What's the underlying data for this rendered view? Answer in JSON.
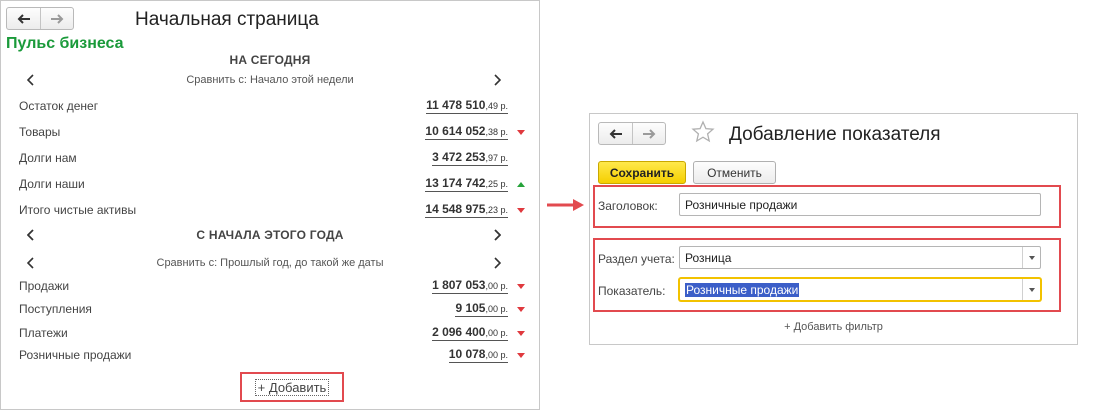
{
  "left": {
    "window_title": "Начальная страница",
    "brand": "Пульс бизнеса",
    "section_today": {
      "heading": "НА СЕГОДНЯ",
      "compare": "Сравнить с: Начало этой недели",
      "rows": [
        {
          "label": "Остаток денег",
          "int": "11 478 510",
          "dec": ",49 р.",
          "trend": "none"
        },
        {
          "label": "Товары",
          "int": "10 614 052",
          "dec": ",38 р.",
          "trend": "down"
        },
        {
          "label": "Долги нам",
          "int": "3 472 253",
          "dec": ",97 р.",
          "trend": "none"
        },
        {
          "label": "Долги наши",
          "int": "13 174 742",
          "dec": ",25 р.",
          "trend": "up"
        },
        {
          "label": "Итого чистые активы",
          "int": "14 548 975",
          "dec": ",23 р.",
          "trend": "down"
        }
      ]
    },
    "section_year": {
      "heading": "С НАЧАЛА ЭТОГО ГОДА",
      "compare": "Сравнить с: Прошлый год, до такой же даты",
      "rows": [
        {
          "label": "Продажи",
          "int": "1 807 053",
          "dec": ",00 р.",
          "trend": "down"
        },
        {
          "label": "Поступления",
          "int": "9 105",
          "dec": ",00 р.",
          "trend": "down"
        },
        {
          "label": "Платежи",
          "int": "2 096 400",
          "dec": ",00 р.",
          "trend": "down"
        },
        {
          "label": "Розничные продажи",
          "int": "10 078",
          "dec": ",00 р.",
          "trend": "down"
        }
      ]
    },
    "add_label": "+ Добавить"
  },
  "right": {
    "window_title": "Добавление показателя",
    "save_label": "Сохранить",
    "cancel_label": "Отменить",
    "heading_label": "Заголовок:",
    "heading_value": "Розничные продажи",
    "section_label": "Раздел учета:",
    "section_value": "Розница",
    "indicator_label": "Показатель:",
    "indicator_value": "Розничные продажи",
    "add_filter_label": "+ Добавить фильтр"
  },
  "colors": {
    "brand": "#1a9a3a",
    "highlight": "#e24a4f",
    "trend_down": "#e0393e",
    "trend_up": "#26a33a",
    "save_button": "#f5cf00",
    "focus": "#f2c200",
    "selection": "#3b5ec8"
  },
  "icons": {
    "back": "arrow-left-icon",
    "forward": "arrow-right-icon",
    "favorite": "star-icon",
    "prev": "chevron-left-icon",
    "next": "chevron-right-icon",
    "dropdown": "chevron-down-icon",
    "pointer": "red-arrow-icon"
  }
}
